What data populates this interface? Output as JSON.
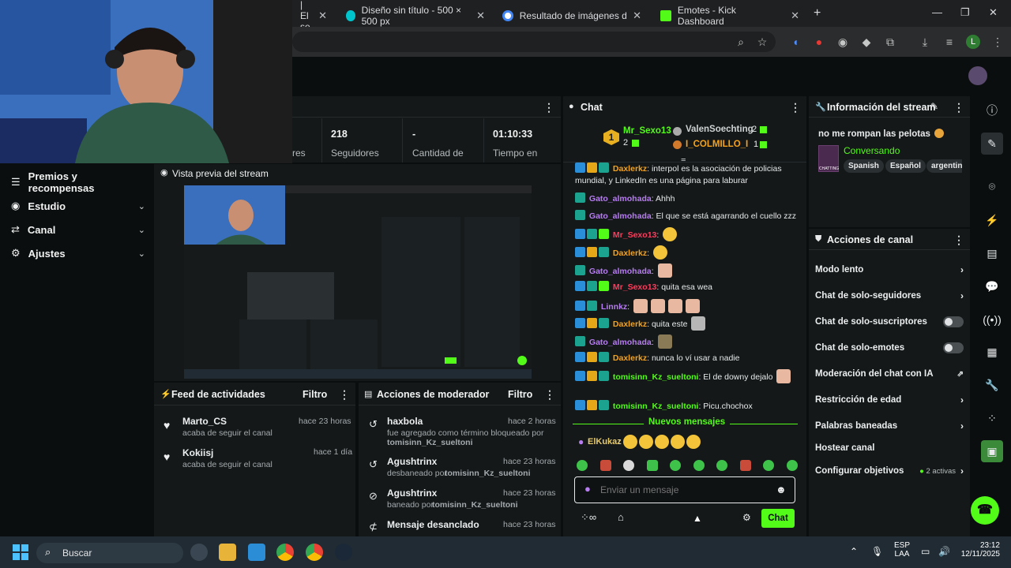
{
  "browser": {
    "tabs": [
      {
        "label": "| El se",
        "fav_color": "#2b2c2e"
      },
      {
        "label": "Diseño sin título - 500 × 500 px",
        "fav_color": "#00c4cc"
      },
      {
        "label": "Resultado de imágenes de Goo",
        "fav_color": "#4285f4"
      },
      {
        "label": "Emotes - Kick Dashboard",
        "fav_color": "#53fc18"
      }
    ],
    "new_tab": "+",
    "profile_initial": "L"
  },
  "sidebar": {
    "items": [
      {
        "label": "Premios y recompensas"
      },
      {
        "label": "Estudio"
      },
      {
        "label": "Canal"
      },
      {
        "label": "Ajustes"
      }
    ]
  },
  "stats": [
    {
      "value": "",
      "label": "res"
    },
    {
      "value": "218",
      "label": "Seguidores"
    },
    {
      "value": "-",
      "label": "Cantidad de"
    },
    {
      "value": "01:10:33",
      "label": "Tiempo en"
    }
  ],
  "preview": {
    "title": "Vista previa del stream"
  },
  "feed": {
    "title": "Feed de actividades",
    "filter": "Filtro",
    "items": [
      {
        "name": "Marto_CS",
        "sub": "acaba de seguir el canal",
        "time": "hace 23 horas"
      },
      {
        "name": "Kokiisj",
        "sub": "acaba de seguir el canal",
        "time": "hace 1 día"
      }
    ]
  },
  "mod": {
    "title": "Acciones de moderador",
    "filter": "Filtro",
    "items": [
      {
        "name": "haxbola",
        "sub": "fue agregado como término bloqueado por",
        "by": "tomisinn_Kz_sueltoni",
        "time": "hace 2 horas"
      },
      {
        "name": "Agushtrinx",
        "sub": "desbaneado por",
        "by": "tomisinn_Kz_sueltoni",
        "time": "hace 23 horas"
      },
      {
        "name": "Agushtrinx",
        "sub": "baneado por",
        "by": "tomisinn_Kz_sueltoni",
        "time": "hace 23 horas"
      },
      {
        "name": "Mensaje desanclado",
        "sub": "",
        "by": "",
        "time": "hace 23 horas"
      }
    ]
  },
  "chat": {
    "title": "Chat",
    "top_gifters": [
      {
        "rank": "1",
        "name": "Mr_Sexo13",
        "count": "2"
      },
      {
        "rank": "",
        "name": "ValenSoechting",
        "count": "2"
      },
      {
        "rank": "",
        "name": "I_COLMILLO_I",
        "count": "1"
      }
    ],
    "messages": [
      {
        "user": "Daxlerkz",
        "color": "#f6a21a",
        "text": "interpol es la asociación de policias mundial, y LinkedIn es una página para laburar"
      },
      {
        "user": "Gato_almohada",
        "color": "#b77cf2",
        "text": "Ahhh"
      },
      {
        "user": "Gato_almohada",
        "color": "#b77cf2",
        "text": "El que se está agarrando el cuello zzz"
      },
      {
        "user": "Mr_Sexo13",
        "color": "#ff3b5c",
        "text": ""
      },
      {
        "user": "Daxlerkz",
        "color": "#f6a21a",
        "text": ""
      },
      {
        "user": "Gato_almohada",
        "color": "#b77cf2",
        "text": ""
      },
      {
        "user": "Mr_Sexo13",
        "color": "#ff3b5c",
        "text": "quita esa wea"
      },
      {
        "user": "Linnkz",
        "color": "#b77cf2",
        "text": ""
      },
      {
        "user": "Daxlerkz",
        "color": "#f6a21a",
        "text": "quita este"
      },
      {
        "user": "Gato_almohada",
        "color": "#b77cf2",
        "text": ""
      },
      {
        "user": "Daxlerkz",
        "color": "#f6a21a",
        "text": "nunca lo ví usar a nadie"
      },
      {
        "user": "tomisinn_Kz_sueltoni",
        "color": "#53fc18",
        "text": "El de downy dejalo"
      },
      {
        "user": "tomisinn_Kz_sueltoni",
        "color": "#53fc18",
        "text": "Picu.chochox"
      }
    ],
    "new_messages": "Nuevos mensajes",
    "last_user": "ElKukaz",
    "input_placeholder": "Enviar un mensaje",
    "send_label": "Chat"
  },
  "stream_info": {
    "title": "Información del stream",
    "stream_title": "no me rompan las pelotas",
    "category": "Conversando",
    "tags": [
      "Spanish",
      "Español",
      "argentina"
    ],
    "thumb_label": "CHATTING"
  },
  "channel_actions": {
    "title": "Acciones de canal",
    "items": [
      {
        "label": "Modo lento",
        "control": "chevron"
      },
      {
        "label": "Chat de solo-seguidores",
        "control": "chevron"
      },
      {
        "label": "Chat de solo-suscriptores",
        "control": "toggle"
      },
      {
        "label": "Chat de solo-emotes",
        "control": "toggle"
      },
      {
        "label": "Moderación del chat con IA",
        "control": "external"
      },
      {
        "label": "Restricción de edad",
        "control": "chevron"
      },
      {
        "label": "Palabras baneadas",
        "control": "chevron"
      },
      {
        "label": "Hostear canal",
        "control": "none"
      },
      {
        "label": "Configurar objetivos",
        "control": "chevron"
      }
    ],
    "objectives_status": "2 activas"
  },
  "taskbar": {
    "search": "Buscar",
    "lang": "ESP",
    "lang2": "LAA",
    "time": "23:12",
    "date": "12/11/2025"
  },
  "colors": {
    "accent": "#53fc18",
    "panel": "#141819",
    "bg": "#0b0e0f"
  }
}
